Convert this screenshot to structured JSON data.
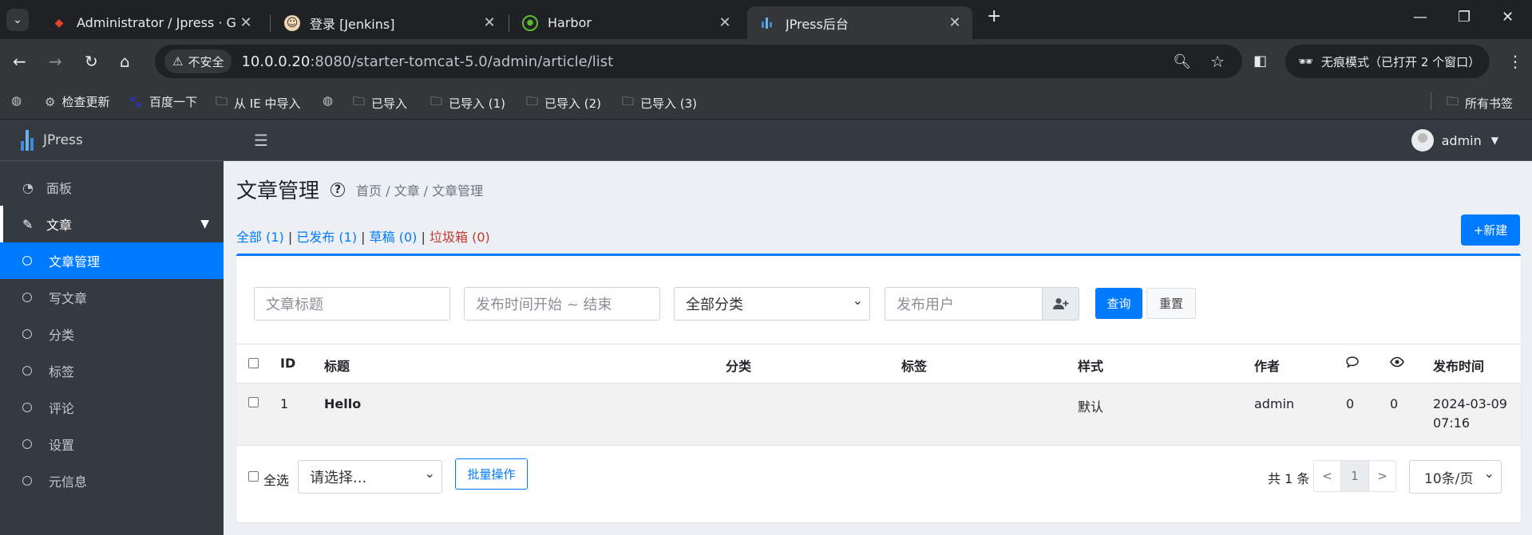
{
  "browser": {
    "tabs": [
      {
        "title": "Administrator / Jpress · GitLab",
        "icon": "gitlab-icon",
        "color": "#e24329"
      },
      {
        "title": "登录 [Jenkins]",
        "icon": "jenkins-icon",
        "color": "#d33833"
      },
      {
        "title": "Harbor",
        "icon": "harbor-icon",
        "color": "#60b932"
      },
      {
        "title": "JPress后台",
        "icon": "jpress-icon",
        "color": "#3d8eda"
      }
    ],
    "security_label": "不安全",
    "url_host": "10.0.0.20",
    "url_path": ":8080/starter-tomcat-5.0/admin/article/list",
    "incognito_label": "无痕模式（已打开 2 个窗口）",
    "bookmarks": [
      {
        "label": "",
        "icon": "globe-icon"
      },
      {
        "label": "检查更新",
        "icon": "gear-icon"
      },
      {
        "label": "百度一下",
        "icon": "baidu-icon"
      },
      {
        "label": "从 IE 中导入",
        "icon": "folder-icon"
      },
      {
        "label": "",
        "icon": "globe-icon"
      },
      {
        "label": "已导入",
        "icon": "folder-icon"
      },
      {
        "label": "已导入 (1)",
        "icon": "folder-icon"
      },
      {
        "label": "已导入 (2)",
        "icon": "folder-icon"
      },
      {
        "label": "已导入 (3)",
        "icon": "folder-icon"
      }
    ],
    "all_bookmarks": "所有书签"
  },
  "sidebar": {
    "brand": "JPress",
    "items": [
      {
        "label": "面板",
        "icon": "dashboard-icon"
      },
      {
        "label": "文章",
        "icon": "edit-icon"
      }
    ],
    "subitems": [
      "文章管理",
      "写文章",
      "分类",
      "标签",
      "评论",
      "设置",
      "元信息"
    ]
  },
  "topnav": {
    "user": "admin"
  },
  "page": {
    "title": "文章管理",
    "breadcrumb": "首页 / 文章 / 文章管理",
    "filters": [
      {
        "label": "全部 (1)"
      },
      {
        "label": "已发布 (1)"
      },
      {
        "label": "草稿 (0)"
      },
      {
        "label": "垃圾箱 (0)"
      }
    ],
    "new_button": "+新建"
  },
  "search": {
    "title_placeholder": "文章标题",
    "date_placeholder": "发布时间开始 ~ 结束",
    "category_value": "全部分类",
    "user_placeholder": "发布用户",
    "query_button": "查询",
    "reset_button": "重置"
  },
  "table": {
    "headers": {
      "id": "ID",
      "title": "标题",
      "category": "分类",
      "tags": "标签",
      "style": "样式",
      "author": "作者",
      "published": "发布时间"
    },
    "rows": [
      {
        "id": "1",
        "title": "Hello",
        "category": "",
        "tags": "",
        "style": "默认",
        "author": "admin",
        "comments": "0",
        "views": "0",
        "date": "2024-03-09",
        "time": "07:16"
      }
    ]
  },
  "footer": {
    "select_all": "全选",
    "batch_select": "请选择...",
    "batch_button": "批量操作",
    "total": "共 1 条",
    "prev": "<",
    "page": "1",
    "next": ">",
    "page_size": "10条/页"
  }
}
